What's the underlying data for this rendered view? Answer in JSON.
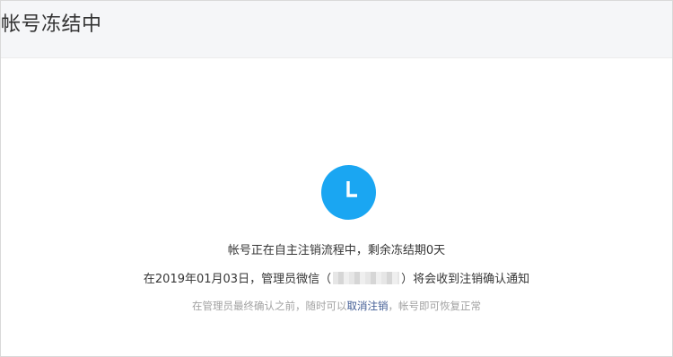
{
  "header": {
    "title": "帐号冻结中"
  },
  "status": {
    "icon": "clock-icon",
    "icon_color": "#1aa6f2",
    "line1": "帐号正在自主注销流程中，剩余冻结期0天",
    "line2_prefix": "在2019年01月03日，管理员微信（",
    "line2_suffix": "）将会收到注销确认通知",
    "hint_prefix": "在管理员最终确认之前，随时可以",
    "cancel_link": "取消注销",
    "hint_suffix": "，帐号即可恢复正常",
    "link_color": "#3f5a93"
  }
}
